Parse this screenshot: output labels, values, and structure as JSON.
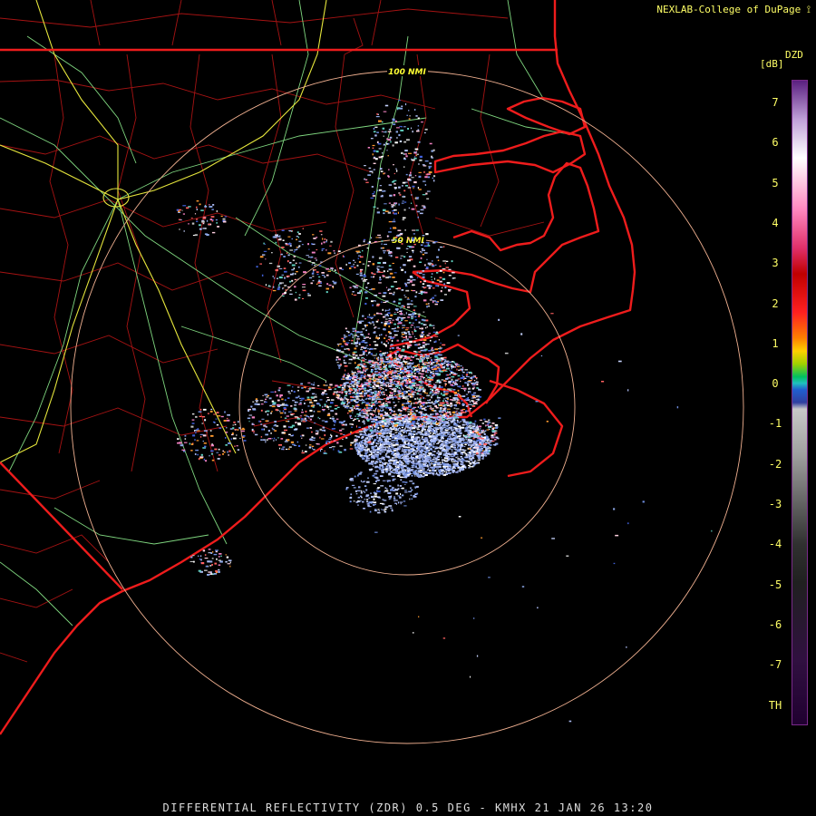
{
  "header": {
    "credit": "NEXLAB-College of DuPage"
  },
  "footer": {
    "product_line": "DIFFERENTIAL REFLECTIVITY (ZDR) 0.5 DEG - KMHX 21 JAN 26 13:20"
  },
  "rings": [
    {
      "label": "100 NMI"
    },
    {
      "label": "50 NMI"
    }
  ],
  "legend": {
    "code": "DZD",
    "unit": "[dB]",
    "ticks": [
      "7",
      "6",
      "5",
      "4",
      "3",
      "2",
      "1",
      "0",
      "-1",
      "-2",
      "-3",
      "-4",
      "-5",
      "-6",
      "-7",
      "TH"
    ]
  },
  "colors": {
    "state_border": "#ee1c1c",
    "county_border": "#aa1414",
    "highway_interstate": "#eeee44",
    "highway_other": "#88dd88",
    "range_ring": "#f0b090",
    "legend_text": "#ffff66"
  }
}
